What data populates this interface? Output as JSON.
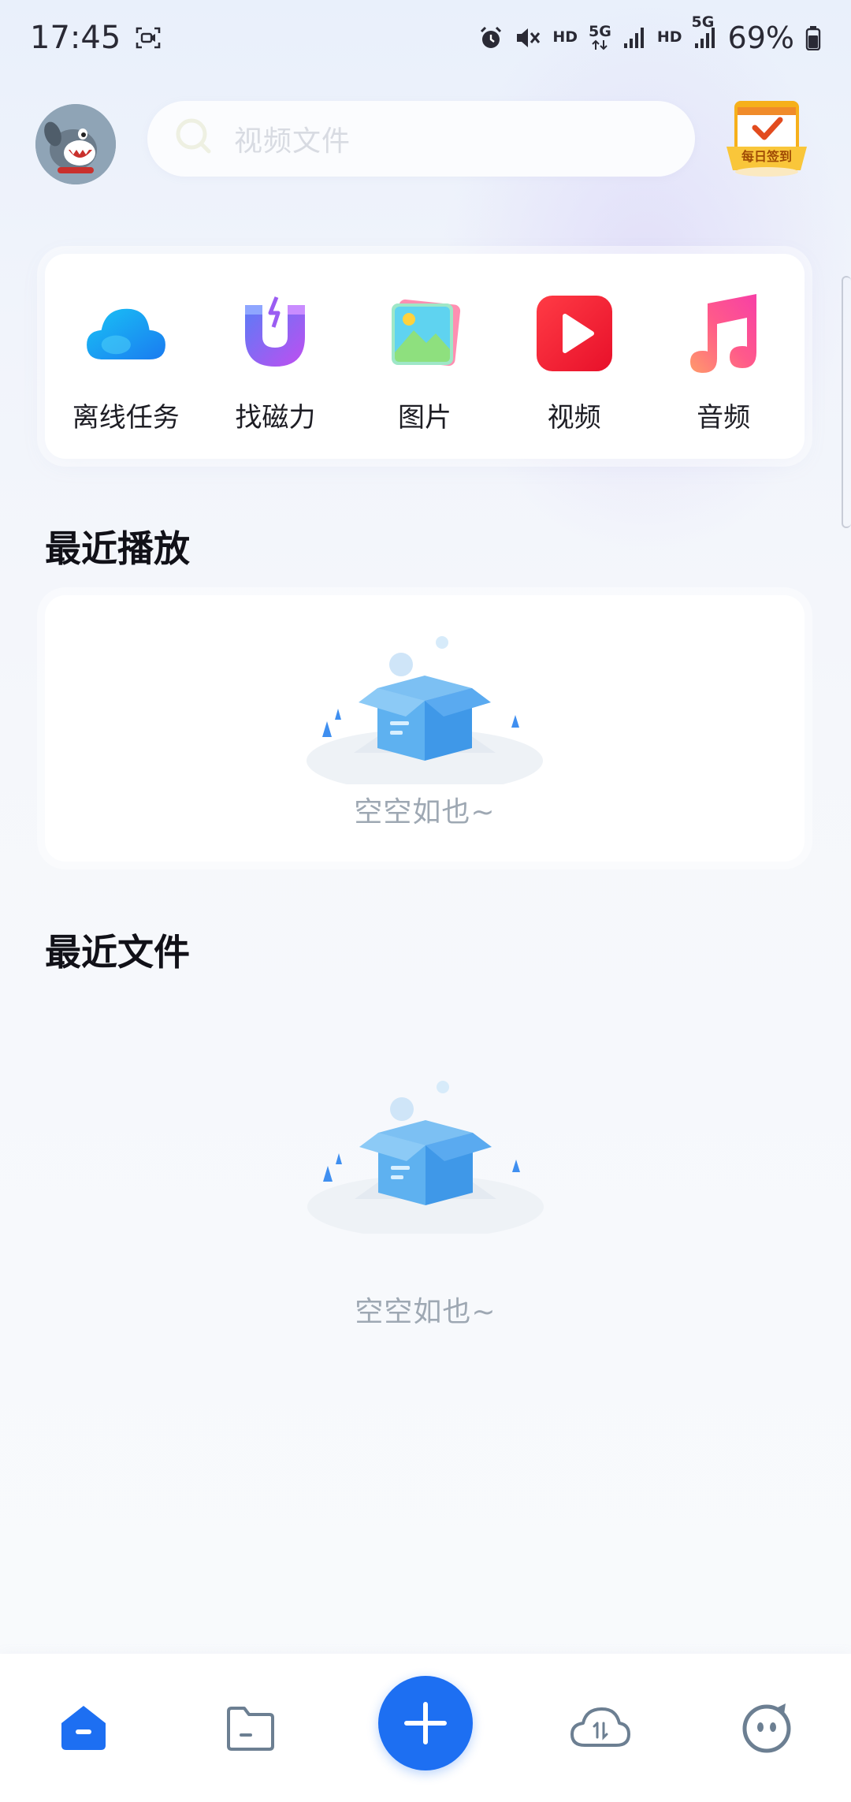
{
  "status_bar": {
    "time": "17:45",
    "battery": "69%",
    "hd1": "HD",
    "net1": "5G",
    "hd2": "HD",
    "net2": "5G",
    "icons": [
      "screen-record-icon",
      "alarm-icon",
      "mute-icon",
      "signal-icon",
      "battery-icon"
    ]
  },
  "header": {
    "search_placeholder": "视频文件",
    "checkin_label": "每日签到"
  },
  "quick_access": [
    {
      "label": "离线任务",
      "icon": "cloud-icon"
    },
    {
      "label": "找磁力",
      "icon": "magnet-icon"
    },
    {
      "label": "图片",
      "icon": "image-icon"
    },
    {
      "label": "视频",
      "icon": "video-play-icon"
    },
    {
      "label": "音频",
      "icon": "music-note-icon"
    }
  ],
  "sections": {
    "recent_play_title": "最近播放",
    "recent_files_title": "最近文件",
    "empty_text": "空空如也~"
  },
  "bottom_nav": [
    {
      "name": "home",
      "icon": "home-icon",
      "active": true
    },
    {
      "name": "files",
      "icon": "folder-icon",
      "active": false
    },
    {
      "name": "add",
      "icon": "plus-icon",
      "active": false
    },
    {
      "name": "transfer",
      "icon": "cloud-transfer-icon",
      "active": false
    },
    {
      "name": "profile",
      "icon": "face-icon",
      "active": false
    }
  ],
  "colors": {
    "accent": "#1d6ff2",
    "text_primary": "#111118",
    "empty_text": "#9ea8b3"
  }
}
